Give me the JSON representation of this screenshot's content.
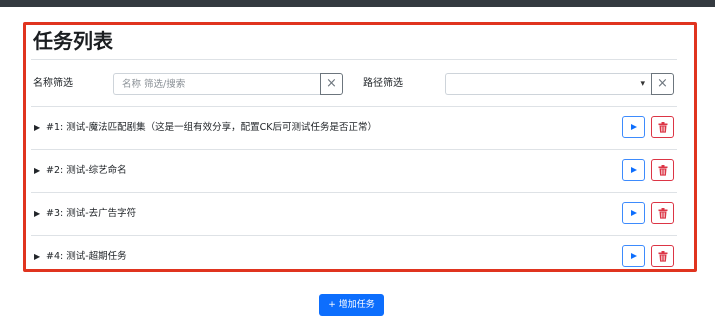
{
  "page": {
    "title": "任务列表"
  },
  "filters": {
    "name_label": "名称筛选",
    "name_placeholder": "名称 筛选/搜索",
    "name_value": "",
    "clear_symbol": "×",
    "path_label": "路径筛选",
    "path_selected": ""
  },
  "tasks": [
    {
      "label": "#1: 测试-魔法匹配剧集（这是一组有效分享，配置CK后可测试任务是否正常）"
    },
    {
      "label": "#2: 测试-综艺命名"
    },
    {
      "label": "#3: 测试-去广告字符"
    },
    {
      "label": "#4: 测试-超期任务"
    }
  ],
  "actions": {
    "add_task_label": "增加任务",
    "add_icon": "+"
  },
  "colors": {
    "highlight_border": "#e0341f",
    "primary": "#0d6efd",
    "danger": "#dc3545",
    "topbar": "#343a40"
  },
  "icons": {
    "caret": "caret-right-icon",
    "run": "play-icon",
    "delete": "trash-icon",
    "clear": "close-icon",
    "select": "chevron-down-icon"
  }
}
